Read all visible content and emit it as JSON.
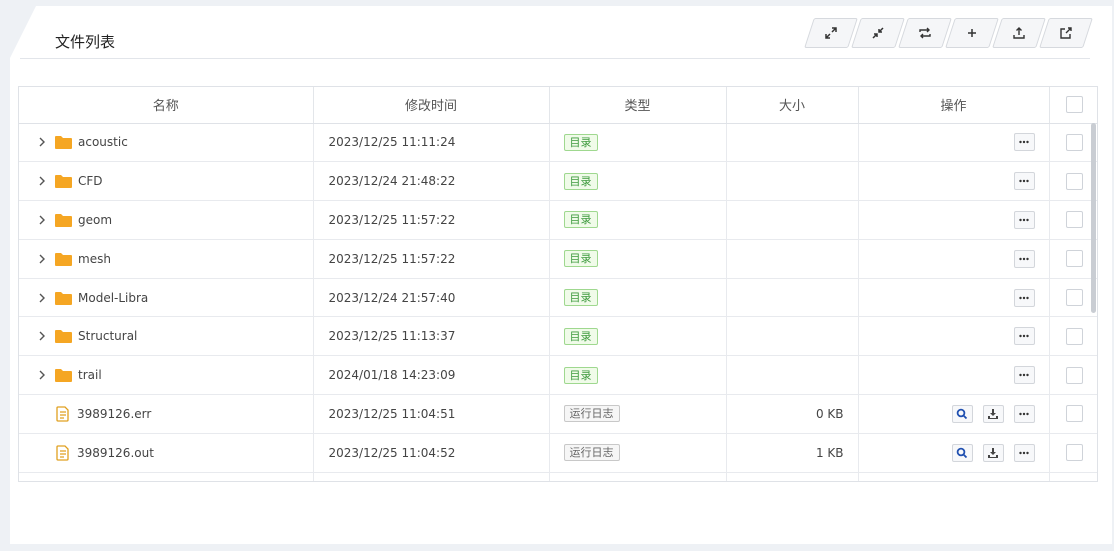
{
  "panel": {
    "title": "文件列表"
  },
  "toolbar": [
    {
      "name": "expand-button",
      "icon": "expand-arrows-icon"
    },
    {
      "name": "collapse-button",
      "icon": "collapse-arrows-icon"
    },
    {
      "name": "refresh-button",
      "icon": "repeat-icon"
    },
    {
      "name": "add-button",
      "icon": "plus-icon"
    },
    {
      "name": "upload-button",
      "icon": "upload-icon"
    },
    {
      "name": "export-button",
      "icon": "share-out-icon"
    }
  ],
  "table": {
    "headers": {
      "name": "名称",
      "modified": "修改时间",
      "type": "类型",
      "size": "大小",
      "ops": "操作"
    },
    "rows": [
      {
        "name": "acoustic",
        "modified": "2023/12/25 11:11:24",
        "type": "目录",
        "size": "",
        "kind": "dir"
      },
      {
        "name": "CFD",
        "modified": "2023/12/24 21:48:22",
        "type": "目录",
        "size": "",
        "kind": "dir"
      },
      {
        "name": "geom",
        "modified": "2023/12/25 11:57:22",
        "type": "目录",
        "size": "",
        "kind": "dir"
      },
      {
        "name": "mesh",
        "modified": "2023/12/25 11:57:22",
        "type": "目录",
        "size": "",
        "kind": "dir"
      },
      {
        "name": "Model-Libra",
        "modified": "2023/12/24 21:57:40",
        "type": "目录",
        "size": "",
        "kind": "dir"
      },
      {
        "name": "Structural",
        "modified": "2023/12/25 11:13:37",
        "type": "目录",
        "size": "",
        "kind": "dir"
      },
      {
        "name": "trail",
        "modified": "2024/01/18 14:23:09",
        "type": "目录",
        "size": "",
        "kind": "dir"
      },
      {
        "name": "3989126.err",
        "modified": "2023/12/25 11:04:51",
        "type": "运行日志",
        "size": "0 KB",
        "kind": "file"
      },
      {
        "name": "3989126.out",
        "modified": "2023/12/25 11:04:52",
        "type": "运行日志",
        "size": "1 KB",
        "kind": "file"
      }
    ]
  },
  "colors": {
    "folder": "#f5a623",
    "file": "#e0a020",
    "dir_tag": "#3d9a3d",
    "search_icon": "#1f4fb0"
  }
}
